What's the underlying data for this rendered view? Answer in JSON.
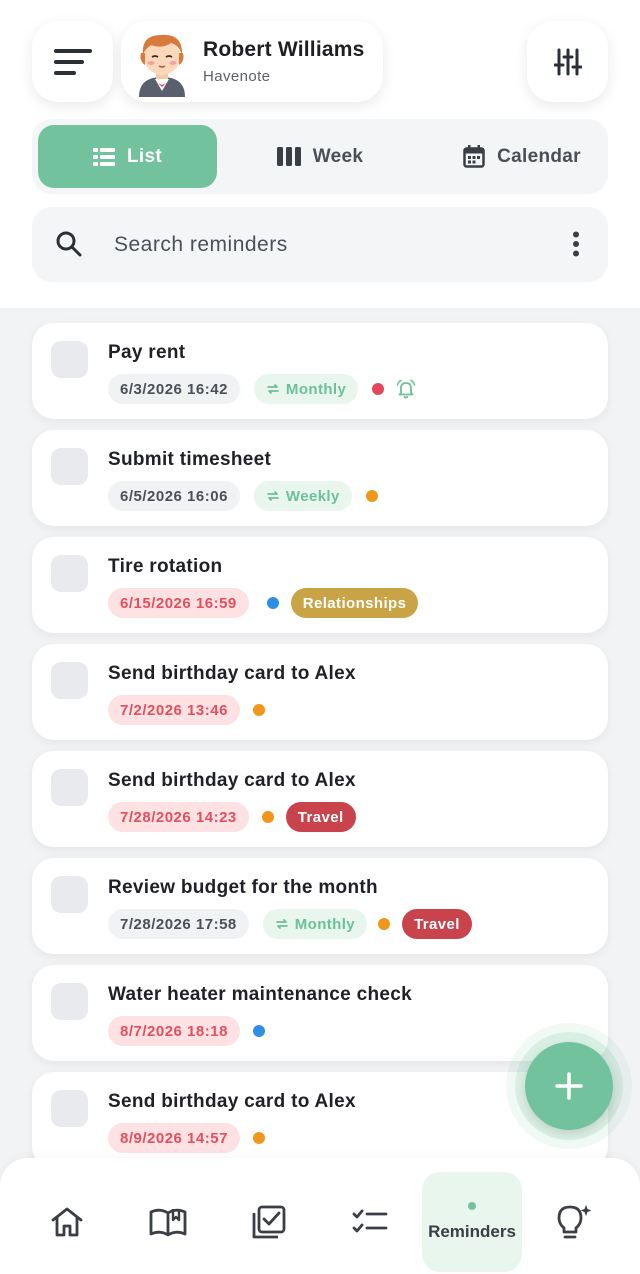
{
  "header": {
    "user_name": "Robert Williams",
    "app_name": "Havenote"
  },
  "views": {
    "list": "List",
    "week": "Week",
    "calendar": "Calendar",
    "active": "List"
  },
  "search": {
    "placeholder": "Search reminders"
  },
  "colors": {
    "accent": "#72c39d",
    "overdue": "#e0505e",
    "dot_red": "#e5475a",
    "dot_orange": "#f0961a",
    "dot_blue": "#2f8fe6",
    "tag_relationships": "#c9a447",
    "tag_travel": "#c9434d"
  },
  "reminders": [
    {
      "title": "Pay rent",
      "date": "6/3/2026 16:42",
      "overdue": false,
      "recurrence": "Monthly",
      "priority": "red",
      "alarm": true,
      "tag": ""
    },
    {
      "title": "Submit timesheet",
      "date": "6/5/2026 16:06",
      "overdue": false,
      "recurrence": "Weekly",
      "priority": "orange",
      "alarm": false,
      "tag": ""
    },
    {
      "title": "Tire rotation",
      "date": "6/15/2026 16:59",
      "overdue": true,
      "recurrence": "",
      "priority": "blue",
      "alarm": false,
      "tag": "Relationships"
    },
    {
      "title": "Send birthday card to Alex",
      "date": "7/2/2026 13:46",
      "overdue": true,
      "recurrence": "",
      "priority": "orange",
      "alarm": false,
      "tag": ""
    },
    {
      "title": "Send birthday card to Alex",
      "date": "7/28/2026 14:23",
      "overdue": true,
      "recurrence": "",
      "priority": "orange",
      "alarm": false,
      "tag": "Travel"
    },
    {
      "title": "Review budget for the month",
      "date": "7/28/2026 17:58",
      "overdue": false,
      "recurrence": "Monthly",
      "priority": "orange",
      "alarm": false,
      "tag": "Travel"
    },
    {
      "title": "Water heater maintenance check",
      "date": "8/7/2026 18:18",
      "overdue": true,
      "recurrence": "",
      "priority": "blue",
      "alarm": false,
      "tag": ""
    },
    {
      "title": "Send birthday card to Alex",
      "date": "8/9/2026 14:57",
      "overdue": true,
      "recurrence": "",
      "priority": "orange",
      "alarm": false,
      "tag": ""
    }
  ],
  "bottom_nav": {
    "items": [
      "home",
      "journal",
      "tasks",
      "checklist",
      "reminders",
      "ideas"
    ],
    "active_label": "Reminders"
  }
}
